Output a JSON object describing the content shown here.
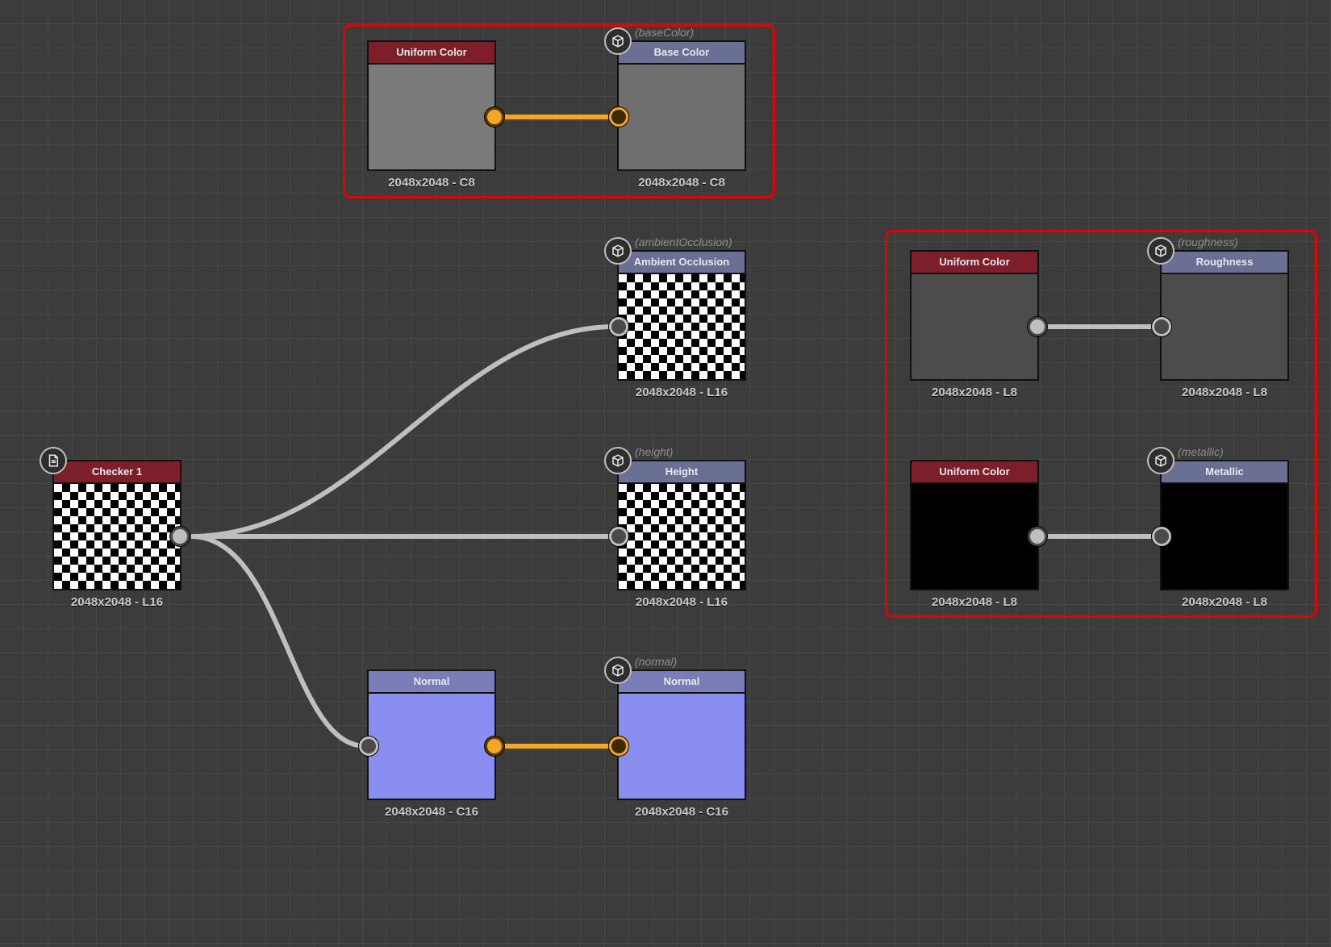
{
  "nodes": {
    "checker": {
      "title": "Checker 1",
      "caption": "2048x2048 - L16"
    },
    "uniform_basecolor": {
      "title": "Uniform Color",
      "caption": "2048x2048 - C8"
    },
    "basecolor": {
      "title": "Base Color",
      "caption": "2048x2048 - C8",
      "label": "(baseColor)"
    },
    "ambient": {
      "title": "Ambient Occlusion",
      "caption": "2048x2048 - L16",
      "label": "(ambientOcclusion)"
    },
    "height": {
      "title": "Height",
      "caption": "2048x2048 - L16",
      "label": "(height)"
    },
    "normal_src": {
      "title": "Normal",
      "caption": "2048x2048 - C16"
    },
    "normal_out": {
      "title": "Normal",
      "caption": "2048x2048 - C16",
      "label": "(normal)"
    },
    "uniform_rough": {
      "title": "Uniform Color",
      "caption": "2048x2048 - L8"
    },
    "roughness": {
      "title": "Roughness",
      "caption": "2048x2048 - L8",
      "label": "(roughness)"
    },
    "uniform_metal": {
      "title": "Uniform Color",
      "caption": "2048x2048 - L8"
    },
    "metallic": {
      "title": "Metallic",
      "caption": "2048x2048 - L8",
      "label": "(metallic)"
    }
  }
}
